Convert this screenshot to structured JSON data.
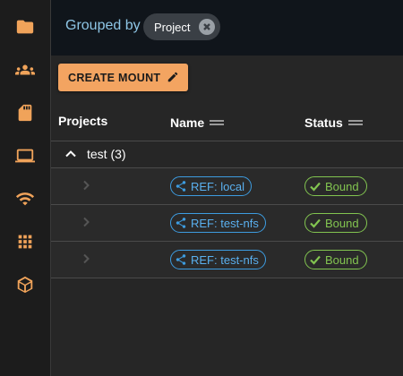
{
  "sidebar": {
    "items": [
      {
        "icon": "folder-icon",
        "name": "sidebar-item-folders"
      },
      {
        "icon": "users-icon",
        "name": "sidebar-item-groups"
      },
      {
        "icon": "sd-card-icon",
        "name": "sidebar-item-storage"
      },
      {
        "icon": "laptop-icon",
        "name": "sidebar-item-devices"
      },
      {
        "icon": "wifi-icon",
        "name": "sidebar-item-network"
      },
      {
        "icon": "apps-grid-icon",
        "name": "sidebar-item-apps"
      },
      {
        "icon": "package-icon",
        "name": "sidebar-item-packages"
      }
    ]
  },
  "toolbar": {
    "grouped_by_label": "Grouped by",
    "group_chip_label": "Project",
    "create_button_label": "CREATE MOUNT"
  },
  "table": {
    "columns": {
      "projects": "Projects",
      "name": "Name",
      "status": "Status"
    },
    "group": {
      "label": "test (3)"
    },
    "rows": [
      {
        "ref": "REF: local",
        "status": "Bound"
      },
      {
        "ref": "REF: test-nfs",
        "status": "Bound"
      },
      {
        "ref": "REF: test-nfs",
        "status": "Bound"
      }
    ]
  },
  "colors": {
    "accent": "#f3a461",
    "link": "#3d9ce0",
    "success": "#82c450",
    "background": "#262626",
    "sidebar": "#1c1c1c"
  }
}
